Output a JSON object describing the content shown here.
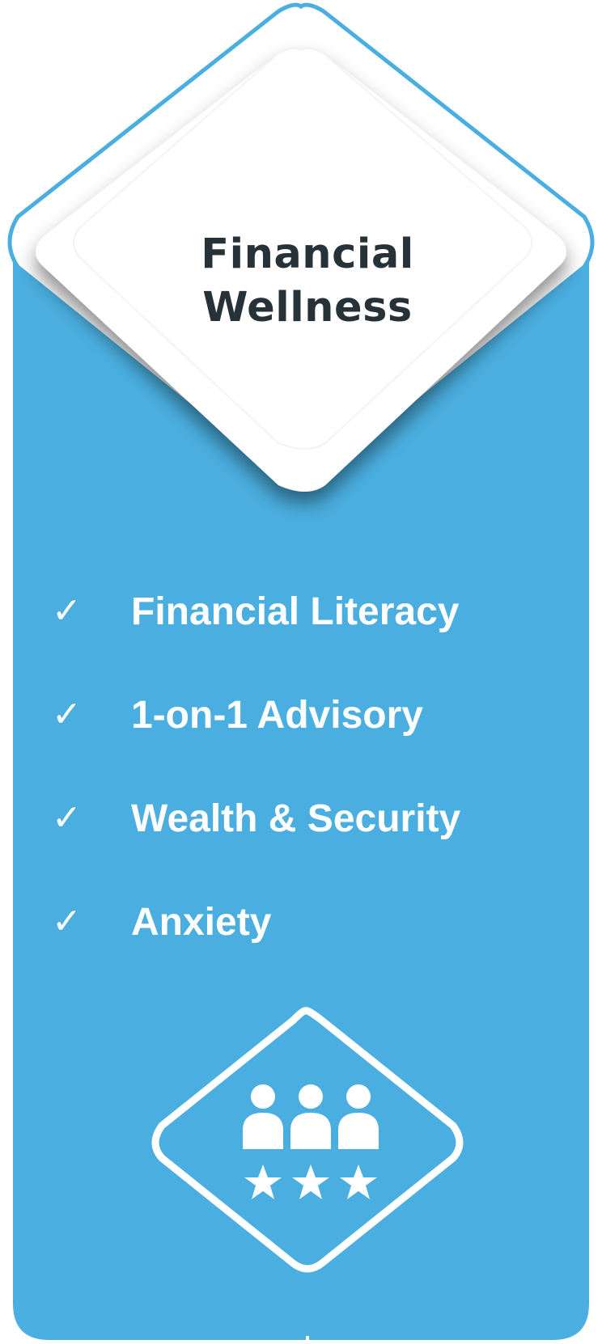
{
  "card": {
    "title_lines": [
      "Financial",
      "Wellness"
    ],
    "accent_color": "#4aafe0",
    "title_color": "#263238",
    "check_icon": "checkmark-icon",
    "items": [
      {
        "label": "Financial Literacy"
      },
      {
        "label": "1-on-1 Advisory"
      },
      {
        "label": "Wealth & Security"
      },
      {
        "label": "Anxiety"
      }
    ],
    "badge": {
      "icon": "team-rating-icon",
      "people_count": 3,
      "stars_count": 3
    }
  }
}
